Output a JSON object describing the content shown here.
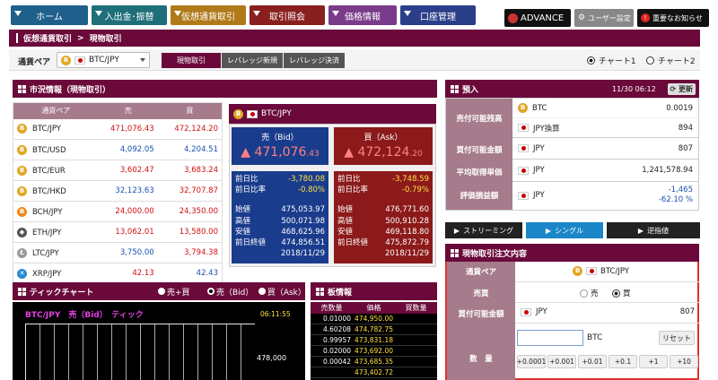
{
  "nav": [
    {
      "label": "ホーム",
      "color": "#1f5f8b"
    },
    {
      "label": "入出金･振替",
      "color": "#1f6f7a"
    },
    {
      "label": "仮想通貨取引",
      "color": "#b07a1a"
    },
    {
      "label": "取引照会",
      "color": "#8a1f1f"
    },
    {
      "label": "価格情報",
      "color": "#7a3b8a"
    },
    {
      "label": "口座管理",
      "color": "#2a3e8a"
    }
  ],
  "top_buttons": {
    "advance": "ADVANCE",
    "user": "ユーザー設定",
    "notice": "重要なお知らせ"
  },
  "breadcrumb": {
    "part1": "仮想通貨取引",
    "sep": ">",
    "part2": "現物取引"
  },
  "pair_label": "通貨ペア",
  "pair_value": "BTC/JPY",
  "trade_tabs": [
    "現物取引",
    "レバレッジ新規",
    "レバレッジ決済"
  ],
  "chart_radio": [
    "チャート1",
    "チャート2"
  ],
  "market": {
    "title": "市況情報（現物取引）",
    "headers": [
      "通貨ペア",
      "売",
      "買"
    ],
    "rows": [
      {
        "pair": "BTC/JPY",
        "sell": "471,076.43",
        "buy": "472,124.20",
        "coin": "B",
        "coinColor": "#e1a725",
        "sc": "red",
        "bc": "red"
      },
      {
        "pair": "BTC/USD",
        "sell": "4,092.05",
        "buy": "4,204.51",
        "coin": "B",
        "coinColor": "#e1a725",
        "sc": "blue",
        "bc": "blue"
      },
      {
        "pair": "BTC/EUR",
        "sell": "3,602.47",
        "buy": "3,683.24",
        "coin": "B",
        "coinColor": "#e1a725",
        "sc": "red",
        "bc": "red"
      },
      {
        "pair": "BTC/HKD",
        "sell": "32,123.63",
        "buy": "32,707.87",
        "coin": "B",
        "coinColor": "#e1a725",
        "sc": "blue",
        "bc": "red"
      },
      {
        "pair": "BCH/JPY",
        "sell": "24,000.00",
        "buy": "24,350.00",
        "coin": "B",
        "coinColor": "#f08a1a",
        "sc": "red",
        "bc": "red"
      },
      {
        "pair": "ETH/JPY",
        "sell": "13,062.01",
        "buy": "13,580.00",
        "coin": "◆",
        "coinColor": "#555",
        "sc": "red",
        "bc": "red"
      },
      {
        "pair": "LTC/JPY",
        "sell": "3,750.00",
        "buy": "3,794.38",
        "coin": "Ł",
        "coinColor": "#999",
        "sc": "blue",
        "bc": "red"
      },
      {
        "pair": "XRP/JPY",
        "sell": "42.13",
        "buy": "42.43",
        "coin": "✕",
        "coinColor": "#2a8ad0",
        "sc": "red",
        "bc": "blue"
      }
    ]
  },
  "quote": {
    "pair": "BTC/JPY",
    "bid": {
      "label": "売（Bid）",
      "price": "471,076",
      "dec": ".43",
      "change_label": "前日比",
      "change": "-3,780.08",
      "ratio_label": "前日比率",
      "ratio": "-0.80%",
      "open_label": "始値",
      "open": "475,053.97",
      "high_label": "高値",
      "high": "500,071.98",
      "low_label": "安値",
      "low": "468,625.96",
      "close_label": "前日終値",
      "close": "474,856.51",
      "date": "2018/11/29"
    },
    "ask": {
      "label": "買（Ask）",
      "price": "472,124",
      "dec": ".20",
      "change_label": "前日比",
      "change": "-3,748.59",
      "ratio_label": "前日比率",
      "ratio": "-0.79%",
      "open_label": "始値",
      "open": "476,771.60",
      "high_label": "高値",
      "high": "500,910.28",
      "low_label": "安値",
      "low": "469,118.80",
      "close_label": "前日終値",
      "close": "475,872.79",
      "date": "2018/11/29"
    }
  },
  "deposit": {
    "title": "預入",
    "time": "11/30 06:12",
    "refresh": "更新",
    "rows": [
      {
        "label": "売付可能残高",
        "items": [
          {
            "cur": "BTC",
            "val": "0.0019",
            "coin": true
          },
          {
            "cur": "JPY換算",
            "val": "894",
            "coin": false
          }
        ]
      },
      {
        "label": "買付可能金額",
        "items": [
          {
            "cur": "JPY",
            "val": "807",
            "coin": false
          }
        ]
      },
      {
        "label": "平均取得単価",
        "items": [
          {
            "cur": "JPY",
            "val": "1,241,578.94",
            "coin": false
          }
        ]
      },
      {
        "label": "評価損益額",
        "items": [
          {
            "cur": "JPY",
            "val": "-1,465",
            "val2": "-62.10 %",
            "coin": false
          }
        ]
      }
    ]
  },
  "modes": [
    "ストリーミング",
    "シングル",
    "逆指値"
  ],
  "tick": {
    "title": "ティックチャート",
    "options": [
      "売+買",
      "売（Bid）",
      "買（Ask）"
    ],
    "chart_title": "BTC/JPY　売（Bid）　ティック",
    "time": "06:11:55",
    "price": "478,000"
  },
  "board": {
    "title": "板情報",
    "headers": [
      "売数量",
      "価格",
      "買数量"
    ],
    "rows": [
      {
        "q": "0.01000",
        "p": "474,950.00"
      },
      {
        "q": "4.60208",
        "p": "474,782.75"
      },
      {
        "q": "0.99957",
        "p": "473,831.18"
      },
      {
        "q": "0.02000",
        "p": "473,692.00"
      },
      {
        "q": "0.00042",
        "p": "473,685.35"
      },
      {
        "q": "",
        "p": "473,402.72"
      }
    ]
  },
  "order": {
    "title": "現物取引注文内容",
    "pair_label": "通貨ペア",
    "pair": "BTC/JPY",
    "side_label": "売買",
    "sell": "売",
    "buy": "買",
    "avail_label": "買付可能金額",
    "avail_cur": "JPY",
    "avail": "807",
    "qty_label": "数　量",
    "qty_unit": "BTC",
    "reset": "リセット",
    "qty_buttons": [
      "+0.0001",
      "+0.001",
      "+0.01",
      "+0.1",
      "+1",
      "+10"
    ]
  }
}
